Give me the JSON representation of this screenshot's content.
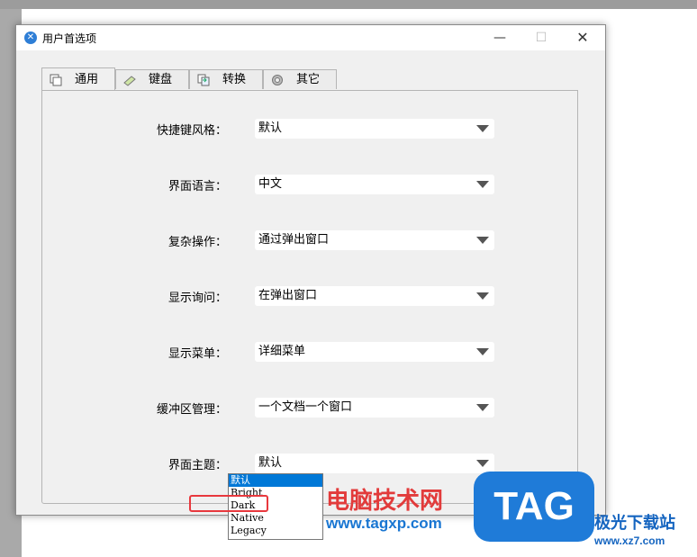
{
  "window": {
    "title": "用户首选项"
  },
  "controls": {
    "minimize": "—",
    "maximize": "☐",
    "close": "✕"
  },
  "tabs": [
    {
      "label": "通用",
      "icon": "window-icon",
      "active": true
    },
    {
      "label": "键盘",
      "icon": "keyboard-icon",
      "active": false
    },
    {
      "label": "转换",
      "icon": "convert-icon",
      "active": false
    },
    {
      "label": "其它",
      "icon": "gear-icon",
      "active": false
    }
  ],
  "settings": [
    {
      "label": "快捷键风格：",
      "value": "默认"
    },
    {
      "label": "界面语言：",
      "value": "中文"
    },
    {
      "label": "复杂操作：",
      "value": "通过弹出窗口"
    },
    {
      "label": "显示询问：",
      "value": "在弹出窗口"
    },
    {
      "label": "显示菜单：",
      "value": "详细菜单"
    },
    {
      "label": "缓冲区管理：",
      "value": "一个文档一个窗口"
    },
    {
      "label": "界面主题：",
      "value": "默认"
    }
  ],
  "theme_dropdown": {
    "options": [
      "默认",
      "Bright",
      "Dark",
      "Native",
      "Legacy"
    ],
    "selected": "默认",
    "highlighted": "Dark"
  },
  "watermark": {
    "line1": "电脑技术网",
    "line2": "www.tagxp.com",
    "badge": "TAG",
    "site_name": "极光下载站",
    "site_url": "www.xz7.com"
  },
  "colors": {
    "selection": "#0078d7",
    "highlight_box": "#e8383d"
  }
}
